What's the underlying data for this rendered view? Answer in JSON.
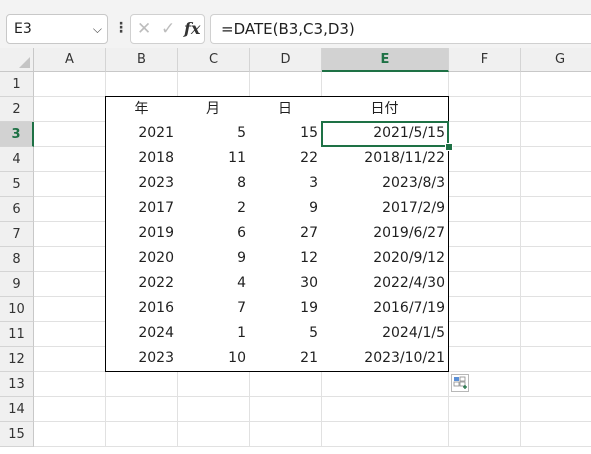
{
  "name_box": {
    "value": "E3"
  },
  "formula_bar": {
    "cancel_glyph": "✕",
    "enter_glyph": "✓",
    "fx_label": "fx",
    "formula": "=DATE(B3,C3,D3)"
  },
  "columns": [
    "A",
    "B",
    "C",
    "D",
    "E",
    "F",
    "G"
  ],
  "rows": [
    "1",
    "2",
    "3",
    "4",
    "5",
    "6",
    "7",
    "8",
    "9",
    "10",
    "11",
    "12",
    "13",
    "14",
    "15"
  ],
  "selected_cell": {
    "column": "E",
    "row": "3"
  },
  "table": {
    "headers": [
      "年",
      "月",
      "日",
      "日付"
    ],
    "rows": [
      [
        "2021",
        "5",
        "15",
        "2021/5/15"
      ],
      [
        "2018",
        "11",
        "22",
        "2018/11/22"
      ],
      [
        "2023",
        "8",
        "3",
        "2023/8/3"
      ],
      [
        "2017",
        "2",
        "9",
        "2017/2/9"
      ],
      [
        "2019",
        "6",
        "27",
        "2019/6/27"
      ],
      [
        "2020",
        "9",
        "12",
        "2020/9/12"
      ],
      [
        "2022",
        "4",
        "30",
        "2022/4/30"
      ],
      [
        "2016",
        "7",
        "19",
        "2016/7/19"
      ],
      [
        "2024",
        "1",
        "5",
        "2024/1/5"
      ],
      [
        "2023",
        "10",
        "21",
        "2023/10/21"
      ]
    ]
  },
  "colors": {
    "accent": "#1e7145",
    "header_bg": "#f0f0f0",
    "gridline": "#e1e1e1"
  }
}
